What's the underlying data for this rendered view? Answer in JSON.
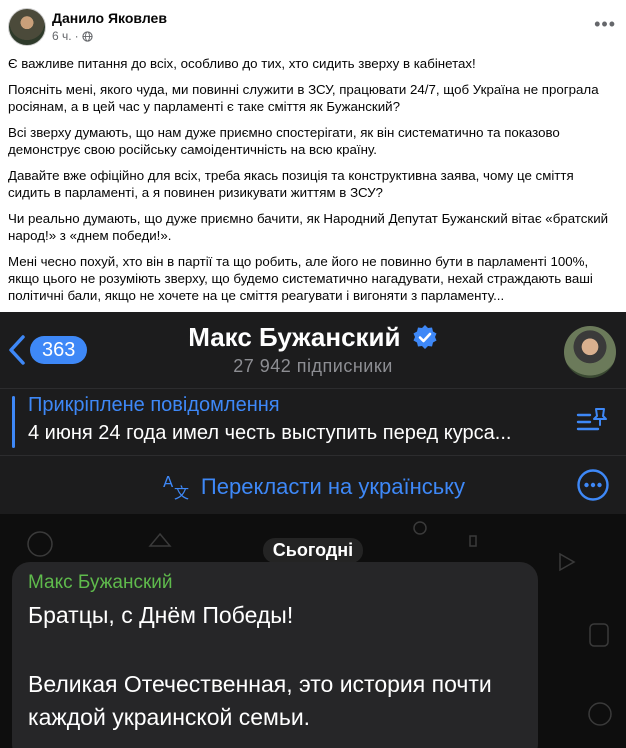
{
  "facebook": {
    "author": "Данило Яковлев",
    "time": "6 ч.",
    "time_separator": "·",
    "more_icon": "more-horizontal-icon",
    "paragraphs": [
      "Є важливе питання до всіх, особливо до тих, хто сидить зверху в кабінетах!",
      "Поясніть мені, якого чуда, ми повинні служити в ЗСУ, працювати 24/7, щоб Україна не програла росіянам, а в цей час у парламенті є таке сміття як Бужанский?",
      "Всі зверху думають, що нам дуже приємно спостерігати, як він систематично та показово демонструє свою російську самоідентичність на всю країну.",
      "Давайте вже офіційно для всіх, треба якась позиція та конструктивна заява, чому це сміття сидить в парламенті, а я повинен ризикувати життям в ЗСУ?",
      "Чи реально думають, що дуже приємно бачити, як Народний Депутат Бужанский вітає «братский народ!» з «днем победи!».",
      "Мені чесно похуй, хто він в партії та що робить, але його не повинно бути в парламенті 100%, якщо цього не розуміють зверху, що будемо систематично нагадувати, нехай страждають ваші політичні бали, якщо не хочете на це сміття реагувати і вигоняти з парламенту..."
    ]
  },
  "telegram": {
    "back_count": "363",
    "channel_name": "Макс Бужанский",
    "subscribers": "27 942 підписники",
    "pinned_title": "Прикріплене повідомлення",
    "pinned_text": "4 июня 24 года имел честь выступить перед курса...",
    "translate_label": "Перекласти на українську",
    "date_chip": "Сьогодні",
    "message": {
      "sender": "Макс Бужанский",
      "line1": "Братцы, с Днём Победы!",
      "line2": "Великая Отечественная, это история почти каждой украинской семьи."
    },
    "colors": {
      "accent": "#3e88f7",
      "sender": "#5fba4c",
      "background": "#1c1c1d"
    }
  }
}
